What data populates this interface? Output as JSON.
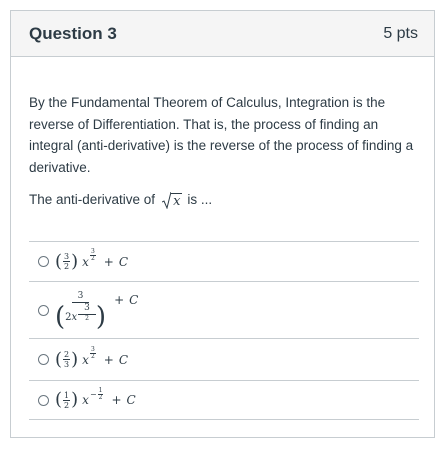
{
  "question": {
    "title": "Question 3",
    "points": "5 pts",
    "text": "By the Fundamental Theorem of Calculus, Integration is the reverse of Differentiation.  That is, the process of finding an integral (anti-derivative) is the reverse of the process of finding a derivative.",
    "prompt_before": "The anti-derivative of",
    "prompt_variable": "x",
    "prompt_after": "is ..."
  },
  "answers": [
    {
      "coef_num": "3",
      "coef_den": "2",
      "var": "x",
      "exp_num": "3",
      "exp_den": "2",
      "plus": "+",
      "const": "C"
    },
    {
      "numerator": "3",
      "den_coef": "2",
      "var": "x",
      "exp_num": "3",
      "exp_den": "2",
      "plus": "+",
      "const": "C"
    },
    {
      "coef_num": "2",
      "coef_den": "3",
      "var": "x",
      "exp_num": "3",
      "exp_den": "2",
      "plus": "+",
      "const": "C"
    },
    {
      "coef_num": "1",
      "coef_den": "2",
      "var": "x",
      "exp_sign": "−",
      "exp_num": "1",
      "exp_den": "2",
      "plus": "+",
      "const": "C"
    }
  ]
}
